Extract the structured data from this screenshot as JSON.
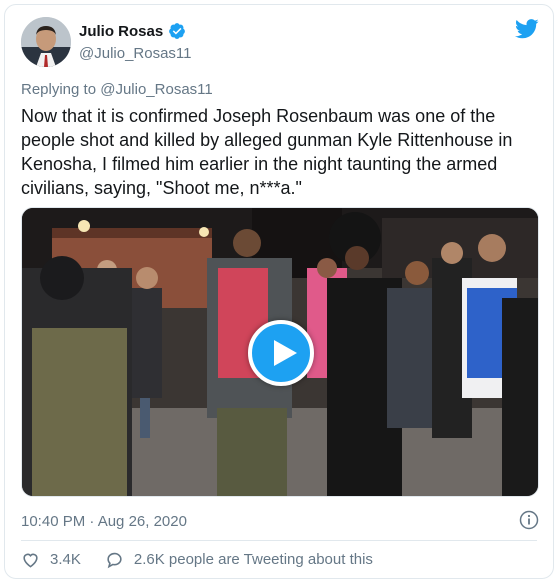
{
  "author": {
    "display_name": "Julio Rosas",
    "handle": "@Julio_Rosas11",
    "verified": true
  },
  "reply": {
    "prefix": "Replying to ",
    "mention": "@Julio_Rosas11"
  },
  "tweet": {
    "text": "Now that it is confirmed Joseph Rosenbaum was one of the people shot and killed by alleged gunman Kyle Rittenhouse in Kenosha, I filmed him earlier in the night taunting the armed civilians, saying, \"Shoot me, n***a.\""
  },
  "meta": {
    "timestamp": "10:40 PM · Aug 26, 2020"
  },
  "stats": {
    "likes": "3.4K",
    "tweeting": "2.6K people are Tweeting about this"
  },
  "icons": {
    "brand": "twitter-bird-icon",
    "verified": "verified-badge-icon",
    "info": "info-icon",
    "like": "heart-icon",
    "comment": "speech-bubble-icon",
    "play": "play-icon"
  },
  "colors": {
    "accent": "#1da1f2",
    "text": "#14171a",
    "secondary": "#657786",
    "border": "#e1e8ed"
  }
}
